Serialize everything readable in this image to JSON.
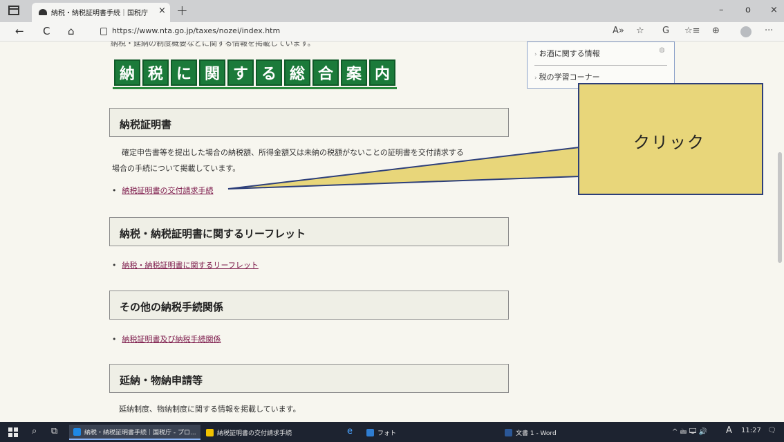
{
  "browser": {
    "tab_title": "納税・納税証明書手続｜国税庁",
    "tab_close": "×",
    "new_tab": "+",
    "url": "https://www.nta.go.jp/taxes/nozei/index.htm",
    "window_buttons": {
      "minimize": "–",
      "restore": "o",
      "close": "×"
    },
    "nav": {
      "back": "←",
      "refresh": "C",
      "home": "⌂"
    },
    "tools": {
      "read_aloud": "A»",
      "favorite": "☆",
      "extensions": "G",
      "favorites_list": "☆≡",
      "collections": "⊕",
      "more": "···"
    }
  },
  "page": {
    "clipped_top_text": "納税・延納の制度概要などに関する情報を掲載しています。",
    "banner_chars": [
      "納",
      "税",
      "に",
      "関",
      "す",
      "る",
      "総",
      "合",
      "案",
      "内"
    ],
    "sidebar": {
      "items": [
        "お酒に関する情報",
        "税の学習コーナー"
      ]
    },
    "sections": [
      {
        "title": "納税証明書",
        "desc_line1": "確定申告書等を提出した場合の納税額、所得金額又は未納の税額がないことの証明書を交付請求する",
        "desc_line2": "場合の手続について掲載しています。",
        "link": "納税証明書の交付請求手続"
      },
      {
        "title": "納税・納税証明書に関するリーフレット",
        "link": "納税・納税証明書に関するリーフレット"
      },
      {
        "title": "その他の納税手続関係",
        "link": "納税証明書及び納税手続関係"
      },
      {
        "title": "延納・物納申請等",
        "desc_line1": "延納制度、物納制度に関する情報を掲載しています。"
      }
    ],
    "bullet": "•",
    "callout": {
      "text": "クリック",
      "fill": "#e8d67a",
      "border": "#2d3f7a"
    }
  },
  "taskbar": {
    "items": [
      {
        "label": "納税・納税証明書手続｜国税庁 - プロ...",
        "color": "#1e88e5"
      },
      {
        "label": "納税証明書の交付請求手続",
        "color": "#f2c200"
      },
      {
        "label": "フォト",
        "color": "#2f7dd1"
      },
      {
        "label": "文書 1 - Word",
        "color": "#2b5797"
      }
    ],
    "tray_icons": "^ 🖮 🖵 🔊",
    "ime": "A",
    "time": "11:27",
    "notification": "🗨"
  }
}
